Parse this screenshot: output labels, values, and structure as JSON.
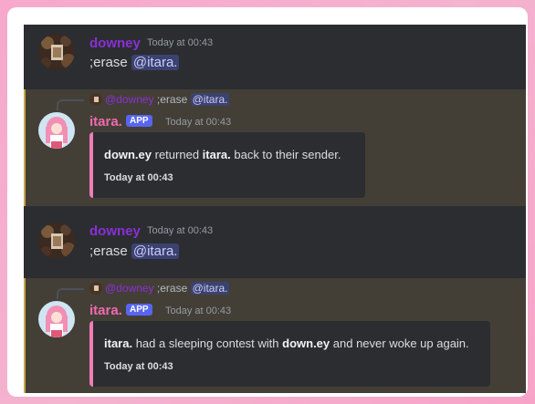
{
  "messages": [
    {
      "author": "downey",
      "timestamp": "Today at 00:43",
      "command": ";erase",
      "mention": "@itara."
    },
    {
      "reply": {
        "author": "@downey",
        "command": ";erase",
        "mention": "@itara."
      },
      "author": "itara.",
      "badge": "APP",
      "timestamp": "Today at 00:43",
      "embed": {
        "part1": "down.ey",
        "part2": " returned ",
        "part3": "itara.",
        "part4": " back to their sender.",
        "footer": "Today at 00:43"
      }
    },
    {
      "author": "downey",
      "timestamp": "Today at 00:43",
      "command": ";erase",
      "mention": "@itara."
    },
    {
      "reply": {
        "author": "@downey",
        "command": ";erase",
        "mention": "@itara."
      },
      "author": "itara.",
      "badge": "APP",
      "timestamp": "Today at 00:43",
      "embed": {
        "part1": "itara.",
        "part2": " had a sleeping contest with ",
        "part3": "down.ey",
        "part4": " and never woke up again.",
        "footer": "Today at 00:43"
      }
    }
  ],
  "colors": {
    "downey_name": "#8b2fd6",
    "itara_name": "#f06ab0",
    "embed_border": "#f27cb6",
    "app_badge": "#5865f2",
    "mention_bg": "#3c4270"
  }
}
